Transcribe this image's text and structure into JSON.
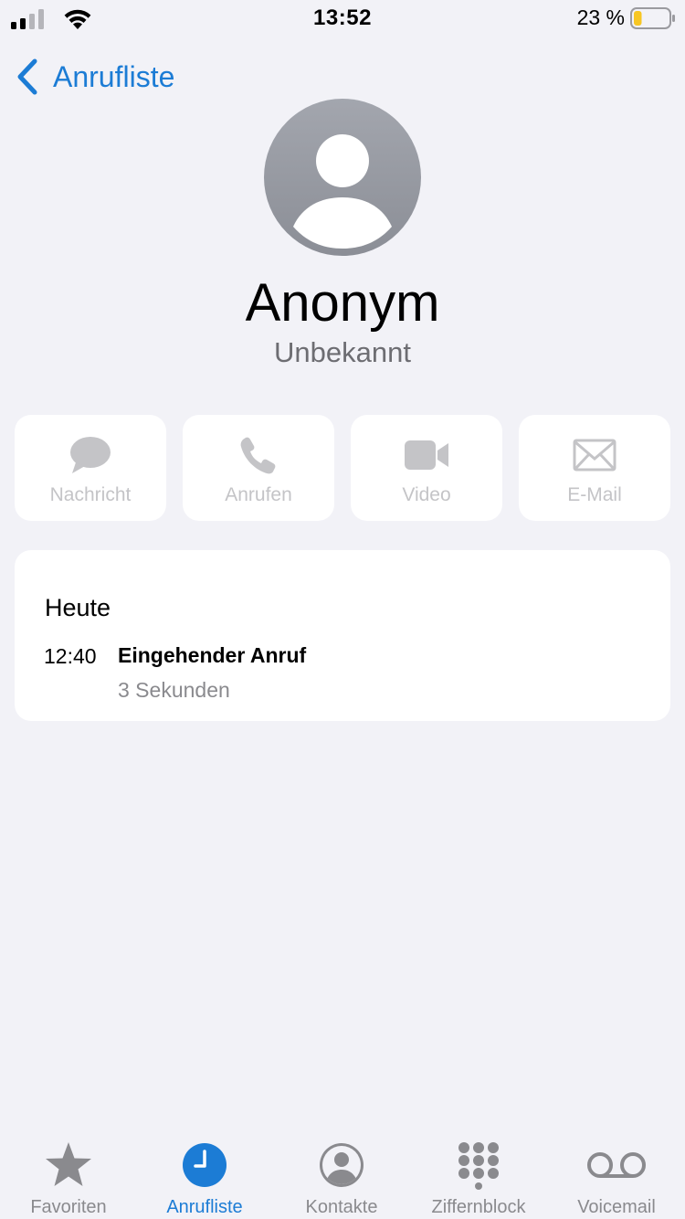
{
  "status_bar": {
    "time": "13:52",
    "battery_text": "23 %",
    "battery_level": 0.23,
    "battery_color": "#f7c623"
  },
  "nav": {
    "back_label": "Anrufliste",
    "back_icon": "chevron-left-icon"
  },
  "contact": {
    "name": "Anonym",
    "subtitle": "Unbekannt"
  },
  "actions": [
    {
      "label": "Nachricht",
      "icon": "message-bubble-icon"
    },
    {
      "label": "Anrufen",
      "icon": "phone-icon"
    },
    {
      "label": "Video",
      "icon": "video-camera-icon"
    },
    {
      "label": "E-Mail",
      "icon": "envelope-icon"
    }
  ],
  "history": {
    "heading": "Heute",
    "calls": [
      {
        "time": "12:40",
        "type": "Eingehender Anruf",
        "duration": "3 Sekunden"
      }
    ]
  },
  "tab_bar": {
    "tabs": [
      {
        "label": "Favoriten",
        "icon": "star-icon",
        "active": false
      },
      {
        "label": "Anrufliste",
        "icon": "clock-icon",
        "active": true
      },
      {
        "label": "Kontakte",
        "icon": "person-circle-icon",
        "active": false
      },
      {
        "label": "Ziffernblock",
        "icon": "keypad-icon",
        "active": false
      },
      {
        "label": "Voicemail",
        "icon": "voicemail-icon",
        "active": false
      }
    ]
  },
  "colors": {
    "accent": "#1c7cd5",
    "background": "#f2f2f7",
    "inactive_tab": "#8a8a8e",
    "disabled_action": "#c4c4c7"
  }
}
